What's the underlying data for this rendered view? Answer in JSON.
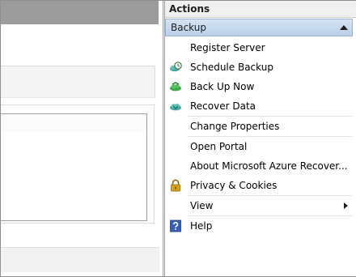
{
  "actions": {
    "header": "Actions",
    "section_title": "Backup",
    "items": [
      {
        "label": "Register Server",
        "icon": "none"
      },
      {
        "label": "Schedule Backup",
        "icon": "schedule-backup-icon"
      },
      {
        "label": "Back Up Now",
        "icon": "backup-now-icon"
      },
      {
        "label": "Recover Data",
        "icon": "recover-data-icon"
      },
      {
        "label": "Change Properties",
        "icon": "none"
      },
      {
        "label": "Open Portal",
        "icon": "none"
      },
      {
        "label": "About Microsoft Azure Recover...",
        "icon": "none"
      },
      {
        "label": "Privacy & Cookies",
        "icon": "lock-icon"
      },
      {
        "label": "View",
        "icon": "none",
        "has_submenu": true
      },
      {
        "label": "Help",
        "icon": "help-icon"
      }
    ]
  },
  "colors": {
    "section_header_bg": "#c4d6ec",
    "cloud_green": "#3ea64a",
    "cloud_teal": "#4aa8a0",
    "help_blue": "#3b5fb4",
    "lock_gold": "#d8a21c"
  }
}
